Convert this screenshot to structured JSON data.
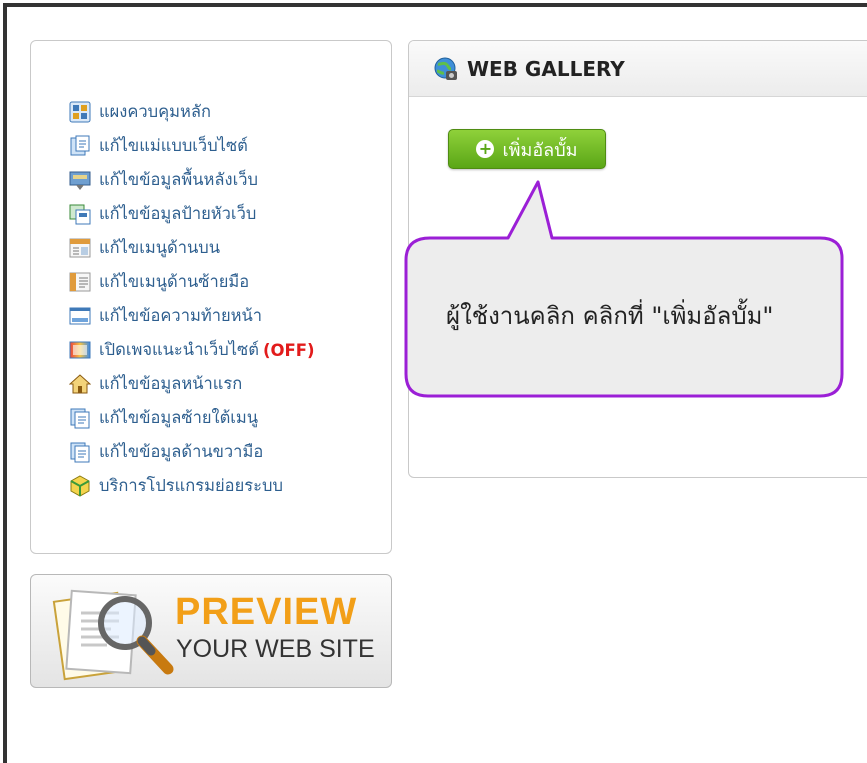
{
  "menu": {
    "items": [
      {
        "label": "แผงควบคุมหลัก",
        "icon": "control-panel-icon"
      },
      {
        "label": "แก้ไขแม่แบบเว็บไซต์",
        "icon": "template-edit-icon"
      },
      {
        "label": "แก้ไขข้อมูลพื้นหลังเว็บ",
        "icon": "background-icon"
      },
      {
        "label": "แก้ไขข้อมูลป้ายหัวเว็บ",
        "icon": "banner-icon"
      },
      {
        "label": "แก้ไขเมนูด้านบน",
        "icon": "top-menu-icon"
      },
      {
        "label": "แก้ไขเมนูด้านซ้ายมือ",
        "icon": "left-menu-icon"
      },
      {
        "label": "แก้ไขข้อความท้ายหน้า",
        "icon": "footer-icon"
      },
      {
        "label": "เปิดเพจแนะนำเว็บไซต์",
        "status": "(OFF)",
        "icon": "intro-page-icon"
      },
      {
        "label": "แก้ไขข้อมูลหน้าแรก",
        "icon": "home-icon"
      },
      {
        "label": "แก้ไขข้อมูลซ้ายใต้เมนู",
        "icon": "document-stack-icon"
      },
      {
        "label": "แก้ไขข้อมูลด้านขวามือ",
        "icon": "document-stack-icon"
      },
      {
        "label": "บริการโปรแกรมย่อยระบบ",
        "icon": "package-icon"
      }
    ]
  },
  "preview": {
    "title": "PREVIEW",
    "subtitle": "YOUR WEB SITE",
    "icon": "magnifier-document-icon"
  },
  "gallery": {
    "title": "WEB GALLERY",
    "icon": "globe-icon",
    "add_album_label": "เพิ่มอัลบั้ม",
    "add_icon": "plus-circle-icon"
  },
  "callout": {
    "text": "ผู้ใช้งานคลิก คลิกที่ \"เพิ่มอัลบั้ม\"",
    "border_color": "#9b1fd6"
  },
  "colors": {
    "menu_text": "#2e5f8f",
    "off_status": "#e21b1b",
    "preview_accent": "#f29f18",
    "button_green": "#6cba1f"
  }
}
